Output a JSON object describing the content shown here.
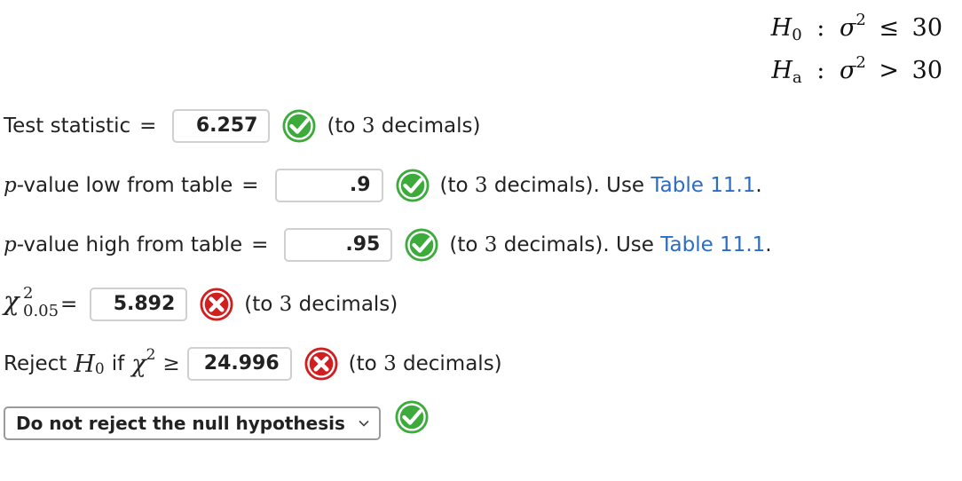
{
  "hypotheses": {
    "h0": {
      "lhs": "H",
      "sub": "0",
      "sep": ":",
      "var": "σ",
      "pow": "2",
      "op": "≤",
      "value": "30"
    },
    "ha": {
      "lhs": "H",
      "sub": "a",
      "sep": ":",
      "var": "σ",
      "pow": "2",
      "op": ">",
      "value": "30"
    }
  },
  "test_statistic": {
    "label": "Test statistic",
    "eq": "=",
    "value": "6.257",
    "status": "correct",
    "note_prefix": "(to",
    "note_num": "3",
    "note_suffix": "decimals)"
  },
  "p_low": {
    "p": "p",
    "label": "-value low from table",
    "eq": "=",
    "value": ".9",
    "status": "correct",
    "note_prefix": "(to",
    "note_num": "3",
    "note_suffix": "decimals). Use",
    "link": "Table 11.1",
    "period": "."
  },
  "p_high": {
    "p": "p",
    "label": "-value high from table",
    "eq": "=",
    "value": ".95",
    "status": "correct",
    "note_prefix": "(to",
    "note_num": "3",
    "note_suffix": "decimals). Use",
    "link": "Table 11.1",
    "period": "."
  },
  "chi_crit": {
    "symbol": "χ",
    "sup": "2",
    "sub": "0.05",
    "eq": "=",
    "value": "5.892",
    "status": "incorrect",
    "note_prefix": "(to",
    "note_num": "3",
    "note_suffix": "decimals)"
  },
  "reject_rule": {
    "prefix": "Reject",
    "h": "H",
    "h_sub": "0",
    "if": "if",
    "chi": "χ",
    "chi_sup": "2",
    "op": "≥",
    "value": "24.996",
    "status": "incorrect",
    "note_prefix": "(to",
    "note_num": "3",
    "note_suffix": "decimals)"
  },
  "conclusion": {
    "selected": "Do not reject the null hypothesis",
    "status": "correct"
  },
  "colors": {
    "correct": "#3cab3c",
    "incorrect": "#d11f1f",
    "link": "#2b6cc4"
  }
}
